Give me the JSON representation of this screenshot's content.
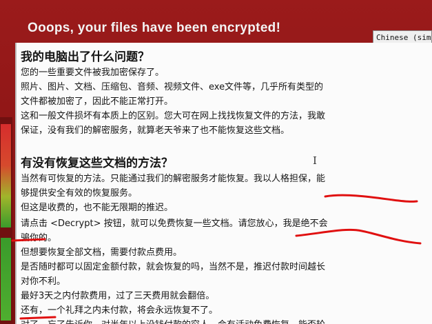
{
  "window": {
    "title": "Ooops, your files have been encrypted!",
    "language_selector": "Chinese (simplified)"
  },
  "section1": {
    "heading": "我的电脑出了什么问题？",
    "lines": [
      "您的一些重要文件被我加密保存了。",
      "照片、图片、文档、压缩包、音频、视频文件、exe文件等，几乎所有类型的",
      "文件都被加密了，因此不能正常打开。",
      "这和一般文件损坏有本质上的区别。您大可在网上找找恢复文件的方法，我敢",
      "保证，没有我们的解密服务，就算老天爷来了也不能恢复这些文档。"
    ]
  },
  "section2": {
    "heading": "有没有恢复这些文档的方法？",
    "lines": [
      "当然有可恢复的方法。只能通过我们的解密服务才能恢复。我以人格担保，能",
      "够提供安全有效的恢复服务。",
      "但这是收费的，也不能无限期的推迟。",
      "请点击 <Decrypt> 按钮，就可以免费恢复一些文档。请您放心，我是绝不会",
      "骗你的。",
      "但想要恢复全部文档，需要付款点费用。",
      "是否随时都可以固定金额付款，就会恢复的吗，当然不是，推迟付款时间越长",
      "对你不利。",
      "最好3天之内付款费用，过了三天费用就会翻倍。",
      "还有，一个礼拜之内未付款，将会永远恢复不了。",
      "对了，忘了告诉你，对半年以上没钱付款的穷人，会有活动免费恢复，能否轮"
    ]
  },
  "colors": {
    "background": "#8e1515",
    "panel": "#fbfbfb",
    "annotation": "#e01010"
  }
}
